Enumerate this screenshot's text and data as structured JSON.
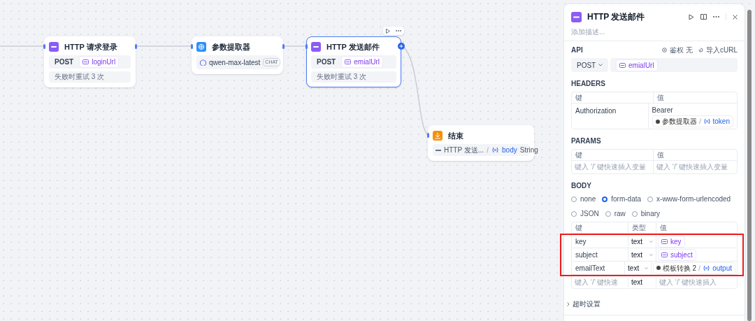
{
  "canvas": {
    "nodes": [
      {
        "kind": "http",
        "title": "HTTP 请求登录",
        "method": "POST",
        "url": "loginUrl",
        "retry": "失败时重试 3 次",
        "selected": false
      },
      {
        "kind": "extractor",
        "title": "参数提取器",
        "model": "qwen-max-latest",
        "badge": "CHAT",
        "selected": false
      },
      {
        "kind": "http",
        "title": "HTTP 发送邮件",
        "method": "POST",
        "url": "emialUrl",
        "retry": "失败时重试 3 次",
        "selected": true
      },
      {
        "kind": "end",
        "title": "结束",
        "source": "HTTP 发送...",
        "variable": "body",
        "type": "String",
        "selected": false
      }
    ]
  },
  "panel": {
    "title": "HTTP 发送邮件",
    "description_placeholder": "添加描述...",
    "api": {
      "label": "API",
      "auth": "鉴权 无",
      "import": "导入cURL",
      "method": "POST",
      "url": "emialUrl"
    },
    "headers": {
      "label": "HEADERS",
      "columns": [
        "键",
        "值"
      ],
      "rows": [
        {
          "key": "Authorization",
          "value": "Bearer",
          "ref_node": "参数提取器",
          "ref_variable": "token"
        }
      ]
    },
    "params": {
      "label": "PARAMS",
      "columns": [
        "键",
        "值"
      ],
      "key_placeholder": "键入 ‘/’ 键快速插入变量",
      "value_placeholder": "键入 ‘/’ 键快速插入变量"
    },
    "body": {
      "label": "BODY",
      "options": [
        {
          "label": "none",
          "selected": false
        },
        {
          "label": "form-data",
          "selected": true
        },
        {
          "label": "x-www-form-urlencoded",
          "selected": false
        },
        {
          "label": "JSON",
          "selected": false
        },
        {
          "label": "raw",
          "selected": false
        },
        {
          "label": "binary",
          "selected": false
        }
      ],
      "columns": [
        "键",
        "类型",
        "值"
      ],
      "rows": [
        {
          "key": "key",
          "type": "text",
          "value": {
            "kind": "var",
            "name": "key"
          }
        },
        {
          "key": "subject",
          "type": "text",
          "value": {
            "kind": "var",
            "name": "subject"
          }
        },
        {
          "key": "emailText",
          "type": "text",
          "value": {
            "kind": "ref",
            "node": "模板转换 2",
            "variable": "output"
          }
        }
      ],
      "new_row": {
        "key_placeholder": "键入 ‘/’ 键快速",
        "type": "text",
        "value_placeholder": "键入 ‘/’ 键快速插入"
      }
    },
    "timeout": {
      "label": "超时设置",
      "expanded": false
    }
  }
}
